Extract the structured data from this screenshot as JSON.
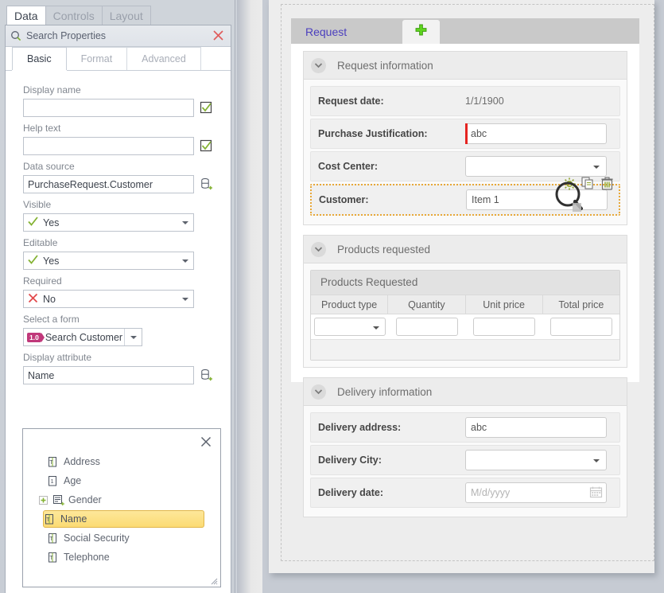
{
  "left_panel": {
    "ribbon_tabs": [
      {
        "label": "Data",
        "active": true
      },
      {
        "label": "Controls",
        "active": false
      },
      {
        "label": "Layout",
        "active": false
      }
    ],
    "search": {
      "placeholder": "Search Properties",
      "text": "Search Properties",
      "icon": "search-icon",
      "close_icon": "close-icon"
    },
    "prop_tabs": [
      {
        "label": "Basic",
        "active": true
      },
      {
        "label": "Format",
        "active": false
      },
      {
        "label": "Advanced",
        "active": false
      }
    ],
    "fields": {
      "display_name": {
        "label": "Display name",
        "value": "",
        "icon": "checkbox-green-check-icon"
      },
      "help_text": {
        "label": "Help text",
        "value": "",
        "icon": "checkbox-green-check-icon"
      },
      "data_source": {
        "label": "Data source",
        "value": "PurchaseRequest.Customer",
        "icon": "database-add-icon"
      },
      "visible": {
        "label": "Visible",
        "value": "Yes",
        "icon": "green-check-icon"
      },
      "editable": {
        "label": "Editable",
        "value": "Yes",
        "icon": "green-check-icon"
      },
      "required": {
        "label": "Required",
        "value": "No",
        "icon": "red-x-icon"
      },
      "select_a_form": {
        "label": "Select a form",
        "value": "Search Customer",
        "version": "1.0"
      },
      "display_attribute": {
        "label": "Display attribute",
        "value": "Name",
        "icon": "database-add-icon"
      }
    },
    "attribute_popup": {
      "close_icon": "close-icon",
      "items": [
        {
          "label": "Address",
          "icon": "text-attribute-icon",
          "selected": false,
          "expandable": false
        },
        {
          "label": "Age",
          "icon": "number-attribute-icon",
          "selected": false,
          "expandable": false
        },
        {
          "label": "Gender",
          "icon": "entity-attribute-icon",
          "selected": false,
          "expandable": true
        },
        {
          "label": "Name",
          "icon": "text-attribute-icon",
          "selected": true,
          "expandable": false
        },
        {
          "label": "Social Security",
          "icon": "text-attribute-icon",
          "selected": false,
          "expandable": false
        },
        {
          "label": "Telephone",
          "icon": "text-attribute-icon",
          "selected": false,
          "expandable": false
        }
      ]
    }
  },
  "designer": {
    "tabs": [
      {
        "label": "Request",
        "active": true
      },
      {
        "label": "",
        "icon": "add-plus-icon",
        "active": false
      }
    ],
    "groups": [
      {
        "title": "Request information",
        "collapse_icon": "chevron-down-icon",
        "rows": [
          {
            "label": "Request date:",
            "control": "static",
            "value": "1/1/1900"
          },
          {
            "label": "Purchase Justification:",
            "control": "text",
            "value": "abc",
            "required": true
          },
          {
            "label": "Cost Center:",
            "control": "select",
            "value": ""
          },
          {
            "label": "Customer:",
            "control": "text",
            "value": "Item 1",
            "selected": true
          }
        ]
      },
      {
        "title": "Products requested",
        "collapse_icon": "chevron-down-icon",
        "grid": {
          "title": "Products Requested",
          "columns": [
            "Product type",
            "Quantity",
            "Unit price",
            "Total price"
          ],
          "rows": [
            {
              "product_type": "",
              "quantity": "",
              "unit_price": "",
              "total_price": ""
            }
          ]
        }
      },
      {
        "title": "Delivery information",
        "collapse_icon": "chevron-down-icon",
        "rows": [
          {
            "label": "Delivery address:",
            "control": "text",
            "value": "abc"
          },
          {
            "label": "Delivery City:",
            "control": "select",
            "value": ""
          },
          {
            "label": "Delivery date:",
            "control": "date",
            "value": "",
            "placeholder": "M/d/yyyy",
            "icon": "calendar-icon"
          }
        ]
      }
    ],
    "row_tools": [
      {
        "name": "settings-gear-icon"
      },
      {
        "name": "duplicate-icon"
      },
      {
        "name": "delete-trash-icon"
      }
    ],
    "cursor": {
      "name": "magnifier-cursor-icon"
    }
  },
  "colors": {
    "accent_purple": "#4b3fbe",
    "selection_orange": "#e8a838",
    "required_red": "#e52421",
    "badge_pink": "#c0387a",
    "green": "#7fb230",
    "panel_bg": "#cdd2d9"
  }
}
